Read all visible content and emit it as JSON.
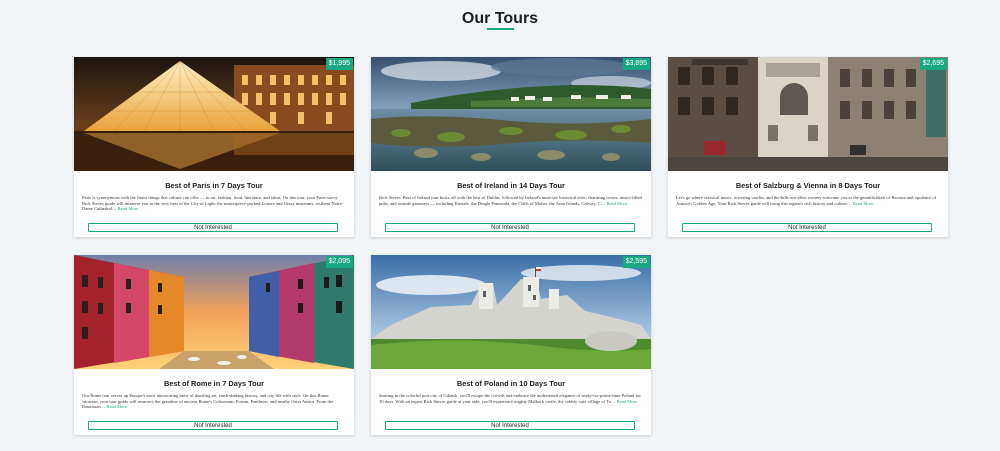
{
  "page": {
    "title": "Our Tours"
  },
  "tours": [
    {
      "name": "Best of Paris in 7 Days Tour",
      "price": "$1,995",
      "info": "Paris is synonymous with the finest things that culture can offer — in art, fashion, food, literature, and ideas. On this tour, your Paris-savvy Rick Steves guide will immerse you in the very best of the City of Light: the masterpiece-packed Louvre and Orsay museums, resilient Notre-Dame Cathedral…",
      "read_more": "Read More",
      "button": "Not Interested"
    },
    {
      "name": "Best of Ireland in 14 Days Tour",
      "price": "$3,895",
      "info": "Rick Steves' Best of Ireland tour kicks off with the best of Dublin, followed by Ireland's must-see historical sites, charming towns, music-filled pubs, and seaside getaways — including Kinsale, the Dingle Peninsula, the Cliffs of Moher, the Aran Islands, Galway, C…",
      "read_more": "Read More",
      "button": "Not Interested"
    },
    {
      "name": "Best of Salzburg & Vienna in 8 Days Tour",
      "price": "$2,695",
      "info": "Let's go where classical music, towering castles, and the-hills-are-alive scenery welcome you to the gemütlichkeit of Bavaria and opulence of Austria's Golden Age. Your Rick Steves guide will bring this region's rich history and culture…",
      "read_more": "Read More",
      "button": "Not Interested"
    },
    {
      "name": "Best of Rome in 7 Days Tour",
      "price": "$2,095",
      "info": "Our Rome tour serves up Europe's most intoxicating brew of dazzling art, earth-shaking history, and city life with style. On this Rome vacation, your tour guide will resurrect the grandeur of ancient Rome's Colosseum, Forum, Pantheon, and nearby Ostia Antica. From the Renaissan…",
      "read_more": "Read More",
      "button": "Not Interested"
    },
    {
      "name": "Best of Poland in 10 Days Tour",
      "price": "$2,595",
      "info": "Starting in the colorful port city of Gdańsk, you'll escape the crowds and embrace the understated elegance of ready-for-prime-time Poland for 10 days. With an expert Rick Steves guide at your side, you'll experience mighty Malbork castle, the cobbly-cute village of To…",
      "read_more": "Read More",
      "button": "Not Interested"
    }
  ],
  "colors": {
    "accent": "#19a982",
    "background": "#f1f5f8"
  }
}
